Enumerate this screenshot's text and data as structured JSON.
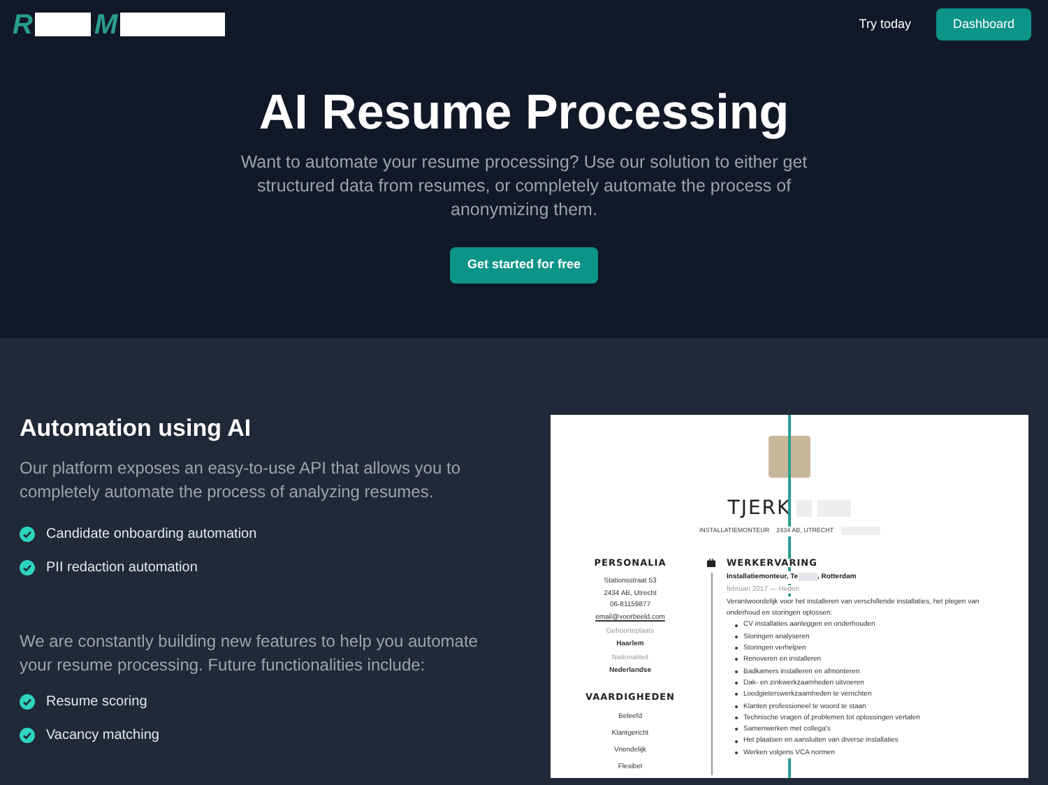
{
  "nav": {
    "logo": [
      "R",
      "M"
    ],
    "links": [
      {
        "label": "Try today",
        "kind": "link"
      },
      {
        "label": "Dashboard",
        "kind": "button"
      }
    ]
  },
  "hero": {
    "title": "AI Resume Processing",
    "subtitle": "Want to automate your resume processing? Use our solution to either get structured data from resumes, or completely automate the process of anonymizing them.",
    "cta": "Get started for free"
  },
  "automation": {
    "heading": "Automation using AI",
    "intro": "Our platform exposes an easy-to-use API that allows you to completely automate the process of analyzing resumes.",
    "features": [
      "Candidate onboarding automation",
      "PII redaction automation"
    ],
    "future_intro": "We are constantly building new features to help you automate your resume processing. Future functionalities include:",
    "future_features": [
      "Resume scoring",
      "Vacancy matching"
    ]
  },
  "resume_preview": {
    "compare_slider": {
      "level": 0.5
    },
    "name": "TJERK",
    "job_title": "INSTALLATIEMONTEUR",
    "location": "2434 AB, UTRECHT",
    "personalia": {
      "heading": "PERSONALIA",
      "lines": [
        "Stationsstraat 53",
        "2434 AB, Utrecht",
        "06-81159877"
      ],
      "email": "email@voorbeeld.com",
      "fields": [
        {
          "label": "Geboorteplaats",
          "value": "Haarlem"
        },
        {
          "label": "Nationaliteit",
          "value": "Nederlandse"
        }
      ]
    },
    "skills": {
      "heading": "VAARDIGHEDEN",
      "items": [
        "Beleefd",
        "Klantgericht",
        "Vriendelijk",
        "Flexibel"
      ]
    },
    "experience": {
      "heading": "WERKERVARING",
      "role": "Installatiemonteur, Te",
      "place": ", Rotterdam",
      "period": "februari 2017 — Heden",
      "description": "Verantwoordelijk voor het installeren van verschillende installaties, het plegen van onderhoud en storingen oplossen:",
      "tasks": [
        "CV installaties aanleggen en onderhouden",
        "Storingen analyseren",
        "Storingen verhelpen",
        "Renoveren en installeren",
        "Badkamers installeren en afmonteren",
        "Dak- en zinkwerkzaamheden uitvoeren",
        "Loodgieterswerkzaamheden te verrichten",
        "Klanten professioneel te woord te staan",
        "Technische vragen of problemen tot oplossingen vertalen",
        "Samenwerken met collega's",
        "Het plaatsen en aansluiten van diverse installaties",
        "Werken volgens VCA normen"
      ]
    }
  }
}
